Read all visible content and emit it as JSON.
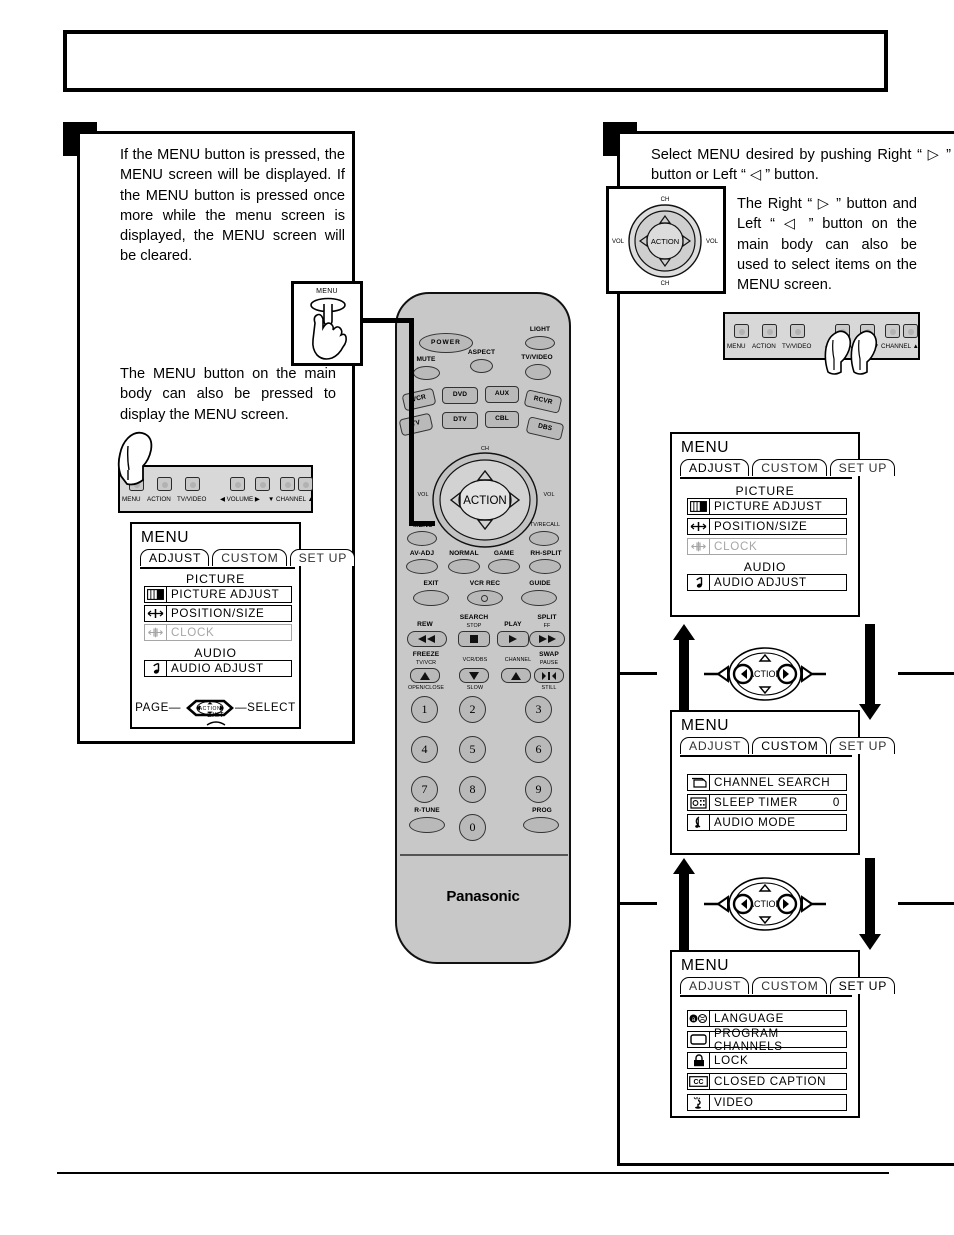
{
  "page": {
    "title_box_text": "",
    "brand": "Panasonic"
  },
  "steps": [
    {
      "marker": "",
      "id": "step-1"
    },
    {
      "marker": "",
      "id": "step-2"
    }
  ],
  "left_panel": {
    "paragraph_1": "If the MENU button is pressed, the MENU screen will be displayed. If the MENU button is pressed once more while the menu screen is displayed, the MENU screen will be cleared.",
    "paragraph_2": "The MENU button on the main body can also be pressed to display the MENU screen.",
    "menu_callout_label": "MENU"
  },
  "right_panel": {
    "paragraph_1": "Select MENU desired by pushing Right “ ▷ ” button or Left “ ◁ ” button.",
    "paragraph_2": "The Right “ ▷ ” button and Left “ ◁ ” button on the main body can also be used to select items on the MENU screen.",
    "joystick": {
      "center": "ACTION",
      "top": "CH",
      "bottom": "CH",
      "left": "VOL",
      "right": "VOL"
    }
  },
  "control_bar": {
    "buttons": [
      "MENU",
      "ACTION",
      "TV/VIDEO",
      "",
      "",
      "",
      ""
    ],
    "labels": {
      "menu": "MENU",
      "action": "ACTION",
      "tvvideo": "TV/VIDEO",
      "volume": "◀ VOLUME ▶",
      "channel": "▼ CHANNEL ▲"
    }
  },
  "osd_menus": [
    {
      "id": "osd-adjust-left",
      "title": "MENU",
      "tabs": [
        {
          "label": "ADJUST",
          "selected": true
        },
        {
          "label": "CUSTOM",
          "selected": false
        },
        {
          "label": "SET  UP",
          "selected": false
        }
      ],
      "sections": [
        {
          "heading": "PICTURE",
          "rows": [
            {
              "icon": "picture-bars-icon",
              "label": "PICTURE  ADJUST",
              "value": "",
              "dimmed": false
            },
            {
              "icon": "position-size-icon",
              "label": "POSITION/SIZE",
              "value": "",
              "dimmed": false
            },
            {
              "icon": "clock-icon",
              "label": "CLOCK",
              "value": "",
              "dimmed": true
            }
          ]
        },
        {
          "heading": "AUDIO",
          "rows": [
            {
              "icon": "music-note-icon",
              "label": "AUDIO  ADJUST",
              "value": "",
              "dimmed": false
            }
          ]
        }
      ],
      "footer": {
        "left": "PAGE",
        "right": "SELECT",
        "center": "ACTION",
        "exit": "EXIT"
      }
    },
    {
      "id": "osd-adjust-right",
      "title": "MENU",
      "tabs": [
        {
          "label": "ADJUST",
          "selected": true
        },
        {
          "label": "CUSTOM",
          "selected": false
        },
        {
          "label": "SET  UP",
          "selected": false
        }
      ],
      "sections": [
        {
          "heading": "PICTURE",
          "rows": [
            {
              "icon": "picture-bars-icon",
              "label": "PICTURE  ADJUST",
              "value": "",
              "dimmed": false
            },
            {
              "icon": "position-size-icon",
              "label": "POSITION/SIZE",
              "value": "",
              "dimmed": false
            },
            {
              "icon": "clock-icon",
              "label": "CLOCK",
              "value": "",
              "dimmed": true
            }
          ]
        },
        {
          "heading": "AUDIO",
          "rows": [
            {
              "icon": "music-note-icon",
              "label": "AUDIO  ADJUST",
              "value": "",
              "dimmed": false
            }
          ]
        }
      ]
    },
    {
      "id": "osd-custom",
      "title": "MENU",
      "tabs": [
        {
          "label": "ADJUST",
          "selected": false
        },
        {
          "label": "CUSTOM",
          "selected": true
        },
        {
          "label": "SET  UP",
          "selected": false
        }
      ],
      "sections": [
        {
          "heading": "",
          "rows": [
            {
              "icon": "channel-search-icon",
              "label": "CHANNEL SEARCH",
              "value": "",
              "dimmed": false
            },
            {
              "icon": "sleep-timer-icon",
              "label": "SLEEP TIMER",
              "value": "0",
              "dimmed": false
            },
            {
              "icon": "audio-mode-icon",
              "label": "AUDIO MODE",
              "value": "",
              "dimmed": false
            }
          ]
        }
      ]
    },
    {
      "id": "osd-setup",
      "title": "MENU",
      "tabs": [
        {
          "label": "ADJUST",
          "selected": false
        },
        {
          "label": "CUSTOM",
          "selected": false
        },
        {
          "label": "SET  UP",
          "selected": true
        }
      ],
      "sections": [
        {
          "heading": "",
          "rows": [
            {
              "icon": "language-icon",
              "label": "LANGUAGE",
              "value": "",
              "dimmed": false
            },
            {
              "icon": "program-channels-icon",
              "label": "PROGRAM  CHANNELS",
              "value": "",
              "dimmed": false
            },
            {
              "icon": "lock-icon",
              "label": "LOCK",
              "value": "",
              "dimmed": false
            },
            {
              "icon": "closed-caption-icon",
              "label": "CLOSED  CAPTION",
              "value": "",
              "dimmed": false
            },
            {
              "icon": "video-icon",
              "label": "VIDEO",
              "value": "",
              "dimmed": false
            }
          ]
        }
      ]
    }
  ],
  "nav_rings": [
    {
      "center": "ACTION",
      "left_arrow": "◁",
      "right_arrow": "▷"
    },
    {
      "center": "ACTION",
      "left_arrow": "◁",
      "right_arrow": "▷"
    }
  ],
  "remote": {
    "brand": "Panasonic",
    "buttons": [
      {
        "name": "power",
        "label": "POWER"
      },
      {
        "name": "light",
        "label": "LIGHT"
      },
      {
        "name": "mute",
        "label": "MUTE"
      },
      {
        "name": "aspect",
        "label": "ASPECT"
      },
      {
        "name": "tvvideo",
        "label": "TV/VIDEO"
      },
      {
        "name": "vcr",
        "label": "VCR"
      },
      {
        "name": "dvd",
        "label": "DVD"
      },
      {
        "name": "aux",
        "label": "AUX"
      },
      {
        "name": "rcvr",
        "label": "RCVR"
      },
      {
        "name": "tv",
        "label": "TV"
      },
      {
        "name": "dtv",
        "label": "DTV"
      },
      {
        "name": "cbl",
        "label": "CBL"
      },
      {
        "name": "dbs",
        "label": "DBS"
      },
      {
        "name": "action",
        "label": "ACTION"
      },
      {
        "name": "ch-up",
        "label": "CH"
      },
      {
        "name": "ch-down",
        "label": "CH"
      },
      {
        "name": "vol-left",
        "label": "VOL"
      },
      {
        "name": "vol-right",
        "label": "VOL"
      },
      {
        "name": "menu",
        "label": "MENU"
      },
      {
        "name": "tv-recall",
        "label": "TV/RECALL"
      },
      {
        "name": "av-adj",
        "label": "AV-ADJ"
      },
      {
        "name": "normal",
        "label": "NORMAL"
      },
      {
        "name": "game",
        "label": "GAME"
      },
      {
        "name": "rh-split",
        "label": "RH-SPLIT"
      },
      {
        "name": "exit",
        "label": "EXIT"
      },
      {
        "name": "vcr-rec",
        "label": "VCR REC"
      },
      {
        "name": "guide",
        "label": "GUIDE"
      },
      {
        "name": "rew",
        "label": "REW"
      },
      {
        "name": "search",
        "label": "SEARCH"
      },
      {
        "name": "stop",
        "label": "STOP"
      },
      {
        "name": "play",
        "label": "PLAY"
      },
      {
        "name": "split",
        "label": "SPLIT"
      },
      {
        "name": "ff",
        "label": "FF"
      },
      {
        "name": "freeze",
        "label": "FREEZE"
      },
      {
        "name": "tv-vcr",
        "label": "TV/VCR"
      },
      {
        "name": "vcr-dbs",
        "label": "VCR/DBS"
      },
      {
        "name": "channel",
        "label": "CHANNEL"
      },
      {
        "name": "swap",
        "label": "SWAP"
      },
      {
        "name": "pause",
        "label": "PAUSE"
      },
      {
        "name": "open-close",
        "label": "OPEN/CLOSE"
      },
      {
        "name": "slow",
        "label": "SLOW"
      },
      {
        "name": "still",
        "label": "STILL"
      },
      {
        "name": "r-tune",
        "label": "R-TUNE"
      },
      {
        "name": "prog",
        "label": "PROG"
      }
    ],
    "numpad": [
      "1",
      "2",
      "3",
      "4",
      "5",
      "6",
      "7",
      "8",
      "9",
      "0"
    ]
  },
  "colors": {
    "ink": "#000000",
    "remote_body": "#c8c8c8",
    "button_face": "#b9b9b9",
    "panel_face": "#d8d8d8",
    "dim_text": "#a6a6a6"
  }
}
